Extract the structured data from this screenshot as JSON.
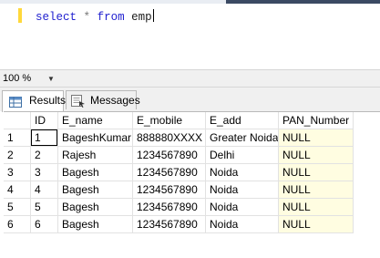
{
  "editor": {
    "keyword_select": "select",
    "star": "*",
    "keyword_from": "from",
    "table": "emp"
  },
  "zoom": {
    "value": "100 %"
  },
  "tabs": [
    {
      "label": "Results",
      "icon": "grid-icon"
    },
    {
      "label": "Messages",
      "icon": "messages-icon"
    }
  ],
  "grid": {
    "columns": [
      "ID",
      "E_name",
      "E_mobile",
      "E_add",
      "PAN_Number"
    ],
    "rows": [
      {
        "num": "1",
        "cells": [
          "1",
          "BageshKumar",
          "888880XXXX",
          "Greater Noida",
          "NULL"
        ]
      },
      {
        "num": "2",
        "cells": [
          "2",
          "Rajesh",
          "1234567890",
          "Delhi",
          "NULL"
        ]
      },
      {
        "num": "3",
        "cells": [
          "3",
          "Bagesh",
          "1234567890",
          "Noida",
          "NULL"
        ]
      },
      {
        "num": "4",
        "cells": [
          "4",
          "Bagesh",
          "1234567890",
          "Noida",
          "NULL"
        ]
      },
      {
        "num": "5",
        "cells": [
          "5",
          "Bagesh",
          "1234567890",
          "Noida",
          "NULL"
        ]
      },
      {
        "num": "6",
        "cells": [
          "6",
          "Bagesh",
          "1234567890",
          "Noida",
          "NULL"
        ]
      }
    ]
  },
  "colors": {
    "keyword": "#1f1fcf",
    "null_bg": "#fffde1",
    "editor_marker": "#ffd83b"
  }
}
